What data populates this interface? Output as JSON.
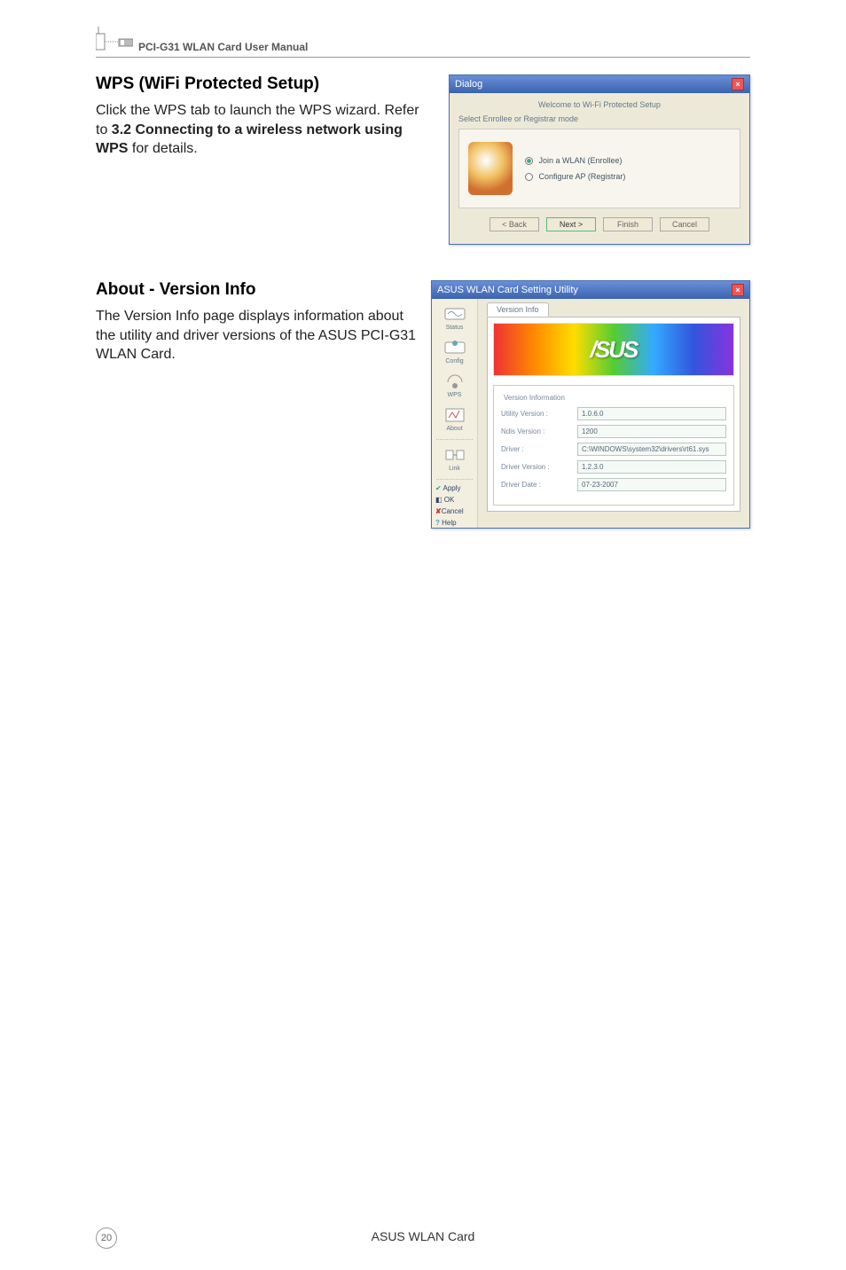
{
  "header": {
    "manual_title": "PCI-G31 WLAN Card User Manual"
  },
  "section_wps": {
    "title": "WPS (WiFi Protected Setup)",
    "body_pre": "Click the WPS tab to launch the WPS wizard. Refer to ",
    "body_bold": "3.2 Connecting to a wireless network using WPS",
    "body_post": " for details."
  },
  "dialog1": {
    "title": "Dialog",
    "welcome": "Welcome to Wi-Fi Protected Setup",
    "mode_label": "Select Enrollee or Registrar mode",
    "radio1": "Join a WLAN (Enrollee)",
    "radio2": "Configure AP (Registrar)",
    "btn_back": "< Back",
    "btn_next": "Next >",
    "btn_finish": "Finish",
    "btn_cancel": "Cancel"
  },
  "section_about": {
    "title": "About - Version Info",
    "body": "The Version Info page displays information about the utility and driver versions of the ASUS PCI-G31 WLAN Card."
  },
  "dialog2": {
    "title": "ASUS WLAN Card Setting Utility",
    "side": {
      "status": "Status",
      "config": "Config",
      "wps": "WPS",
      "about": "About",
      "link": "Link",
      "apply": "Apply",
      "ok": "OK",
      "cancel": "Cancel",
      "help": "Help"
    },
    "tab_label": "Version Info",
    "logo_text": "/SUS",
    "group_label": "Version Information",
    "rows": {
      "utility_label": "Utility Version :",
      "utility_val": "1.0.6.0",
      "ndis_label": "Ndis Version :",
      "ndis_val": "1200",
      "driver_label": "Driver :",
      "driver_val": "C:\\WINDOWS\\system32\\drivers\\rt61.sys",
      "drvver_label": "Driver Version :",
      "drvver_val": "1.2.3.0",
      "drvdate_label": "Driver Date :",
      "drvdate_val": "07-23-2007"
    }
  },
  "footer": {
    "text": "ASUS WLAN Card",
    "page": "20"
  }
}
